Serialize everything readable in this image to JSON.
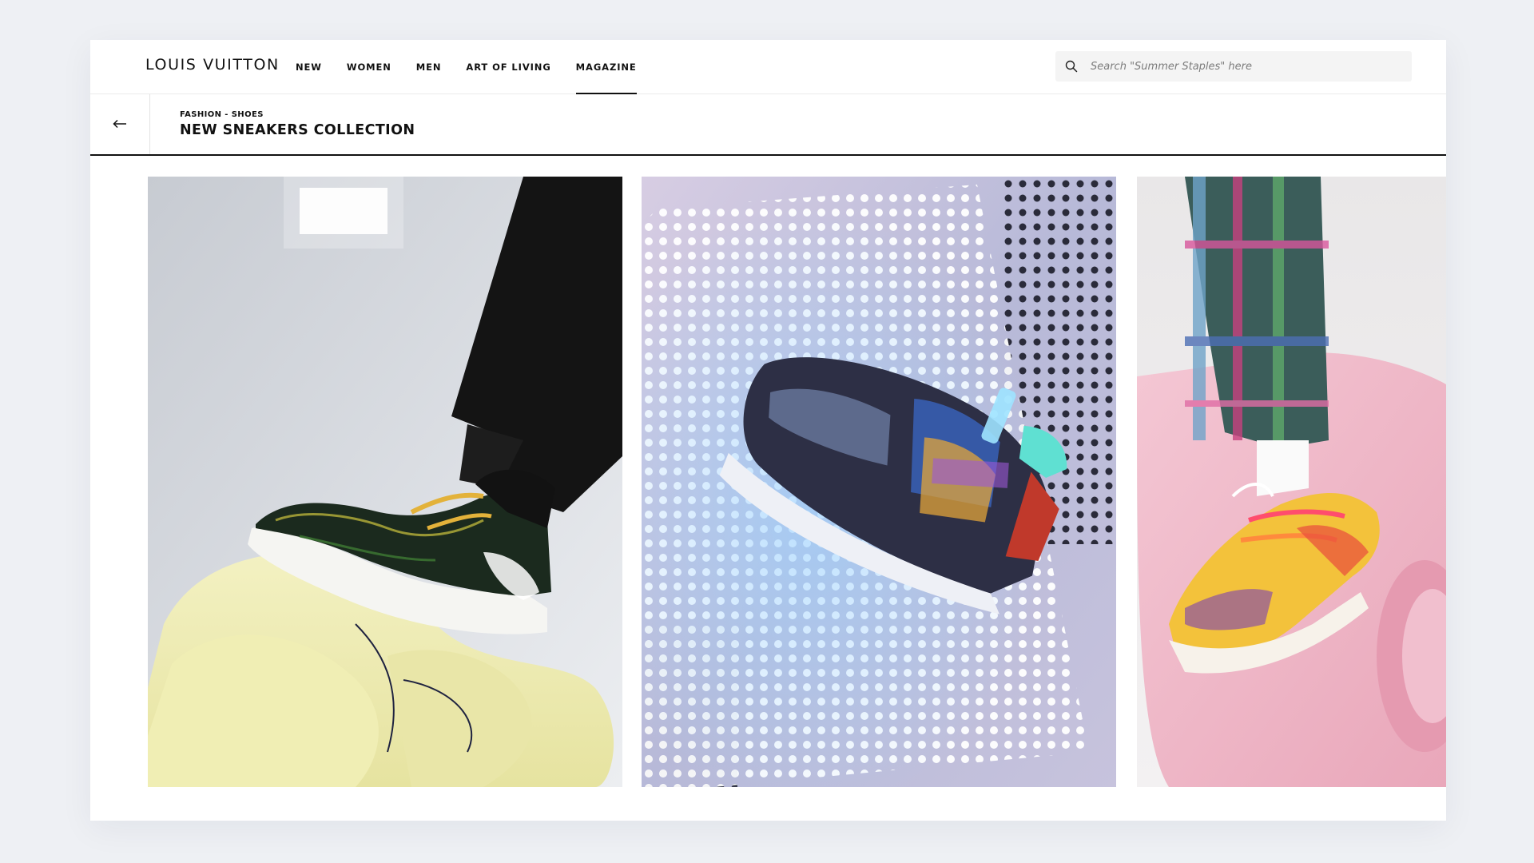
{
  "brand": {
    "logo_text": "LOUIS VUITTON"
  },
  "nav": {
    "items": [
      {
        "label": "NEW"
      },
      {
        "label": "WOMEN"
      },
      {
        "label": "MEN"
      },
      {
        "label": "ART OF LIVING"
      },
      {
        "label": "MAGAZINE",
        "active": true
      }
    ]
  },
  "search": {
    "placeholder": "Search \"Summer Staples\" here",
    "value": "",
    "icon": "search-icon"
  },
  "header": {
    "back_icon": "arrow-left-icon",
    "breadcrumb": "FASHION - SHOES",
    "title": "NEW SNEAKERS COLLECTION"
  },
  "gallery": {
    "images": [
      {
        "alt": "sneaker-on-yellow-foam",
        "icon": "image"
      },
      {
        "alt": "trainer-on-perforated-light-panel",
        "icon": "image"
      },
      {
        "alt": "colorful-sneaker-on-pink-roll",
        "icon": "image"
      }
    ]
  },
  "colors": {
    "background": "#eef0f4",
    "surface": "#ffffff",
    "text": "#111111",
    "search_bg": "#f4f4f4"
  }
}
